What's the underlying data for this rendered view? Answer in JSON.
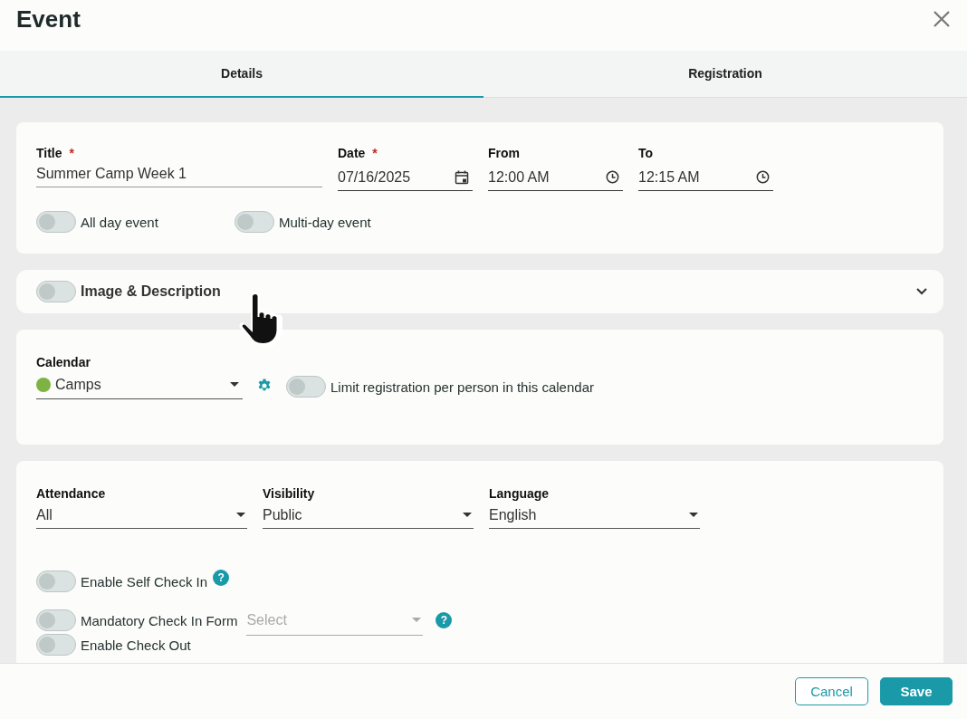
{
  "window": {
    "title": "Event"
  },
  "tabs": [
    {
      "label": "Details",
      "selected": true
    },
    {
      "label": "Registration",
      "selected": false
    }
  ],
  "basics": {
    "fields": [
      {
        "kind": "text",
        "label": "Title",
        "required_mark": "*",
        "value": "Summer Camp Week 1"
      },
      {
        "kind": "date",
        "label": "Date",
        "required_mark": "*",
        "value": "07/16/2025"
      },
      {
        "kind": "time",
        "label": "From",
        "value": "12:00 AM"
      },
      {
        "kind": "time",
        "label": "To",
        "value": "12:15 AM"
      }
    ],
    "toggles": [
      {
        "label": "All day event",
        "on": false
      },
      {
        "label": "Multi-day event",
        "on": false
      }
    ]
  },
  "image_description": {
    "label": "Image & Description",
    "on": false,
    "expanded": false
  },
  "calendar": {
    "label": "Calendar",
    "value": "Camps",
    "color": "#7cb342",
    "toggle": {
      "label": "Limit registration per person in this calendar",
      "on": false
    }
  },
  "options": {
    "selects": [
      {
        "label": "Attendance",
        "value": "All"
      },
      {
        "label": "Visibility",
        "value": "Public"
      },
      {
        "label": "Language",
        "value": "English"
      }
    ],
    "toggles": [
      {
        "label": "Enable Self Check In",
        "on": false,
        "help_icon": "?"
      },
      {
        "label": "Mandatory Check In Form",
        "on": false,
        "select": {
          "placeholder": "Select"
        },
        "help_icon": "?"
      },
      {
        "label": "Enable Check Out",
        "on": false
      }
    ]
  },
  "buttons": [
    {
      "label": "Cancel",
      "kind": "secondary"
    },
    {
      "label": "Save",
      "kind": "primary"
    }
  ]
}
